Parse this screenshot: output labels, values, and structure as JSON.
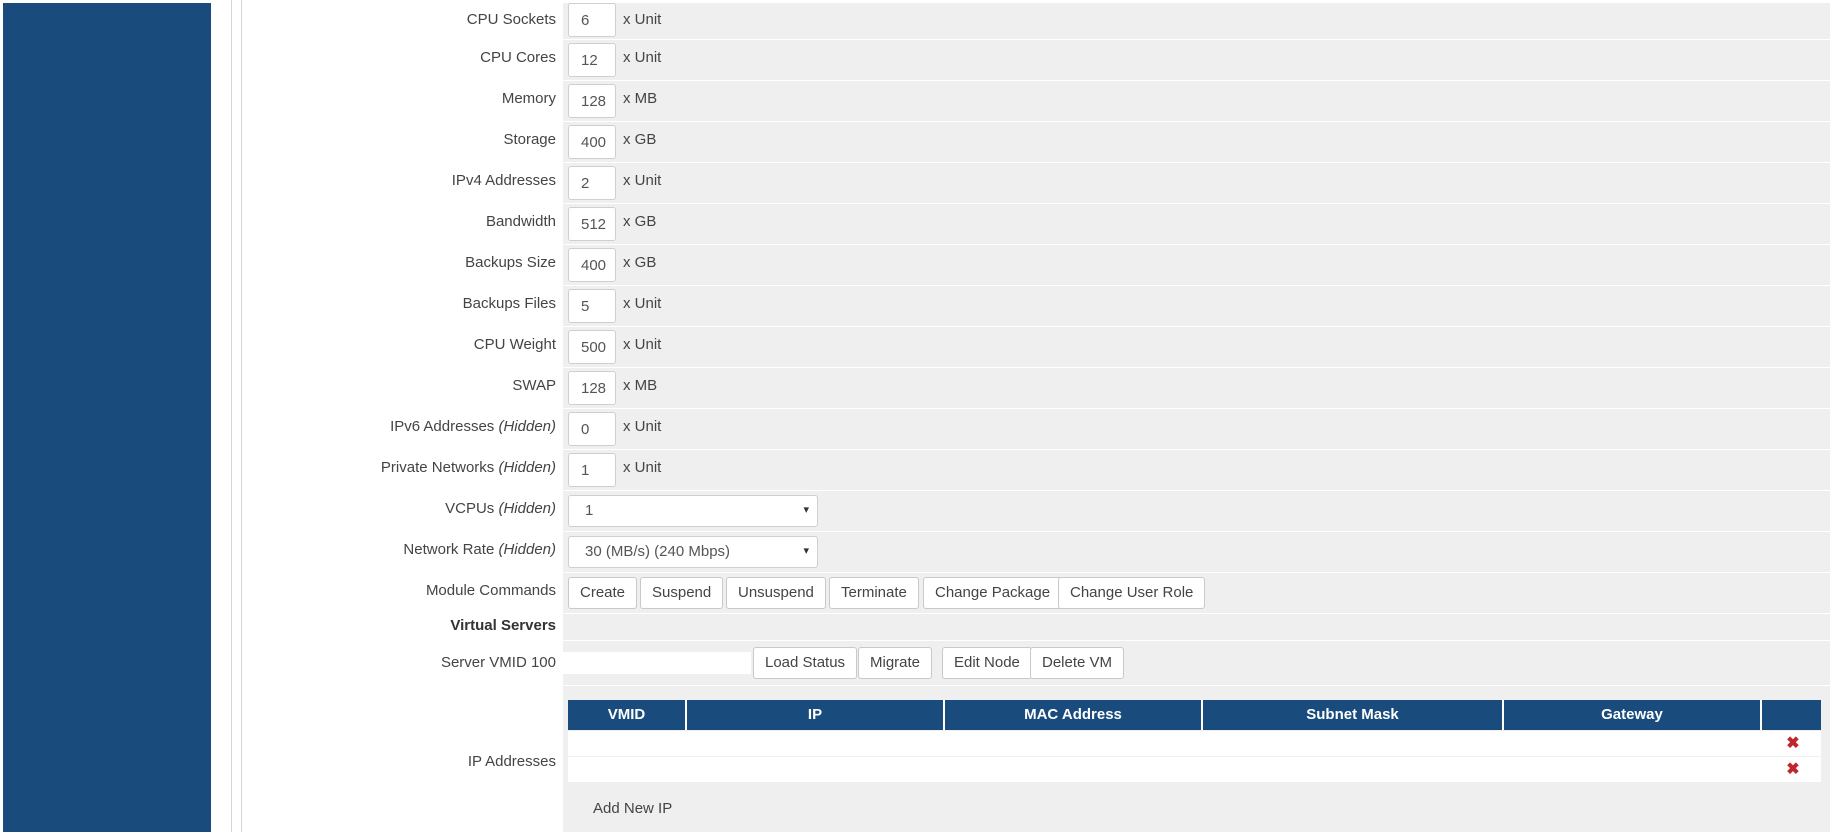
{
  "fields": [
    {
      "label": "CPU Sockets",
      "value": "6",
      "unit": "x Unit"
    },
    {
      "label": "CPU Cores",
      "value": "12",
      "unit": "x Unit"
    },
    {
      "label": "Memory",
      "value": "128",
      "unit": "x MB"
    },
    {
      "label": "Storage",
      "value": "400",
      "unit": "x GB"
    },
    {
      "label": "IPv4 Addresses",
      "value": "2",
      "unit": "x Unit"
    },
    {
      "label": "Bandwidth",
      "value": "512",
      "unit": "x GB"
    },
    {
      "label": "Backups Size",
      "value": "400",
      "unit": "x GB"
    },
    {
      "label": "Backups Files",
      "value": "5",
      "unit": "x Unit"
    },
    {
      "label": "CPU Weight",
      "value": "500",
      "unit": "x Unit"
    },
    {
      "label": "SWAP",
      "value": "128",
      "unit": "x MB"
    },
    {
      "label": "IPv6 Addresses",
      "hidden": "(Hidden)",
      "value": "0",
      "unit": "x Unit"
    },
    {
      "label": "Private Networks",
      "hidden": "(Hidden)",
      "value": "1",
      "unit": "x Unit"
    }
  ],
  "vcpus": {
    "label": "VCPUs",
    "hidden": "(Hidden)",
    "value": "1"
  },
  "network_rate": {
    "label": "Network Rate",
    "hidden": "(Hidden)",
    "value": "30 (MB/s) (240 Mbps)"
  },
  "module_commands": {
    "label": "Module Commands",
    "buttons": [
      "Create",
      "Suspend",
      "Unsuspend",
      "Terminate",
      "Change Package",
      "Change User Role"
    ]
  },
  "virtual_servers": {
    "label": "Virtual Servers"
  },
  "server_vmid": {
    "label": "Server VMID 100",
    "value": "",
    "buttons": [
      "Load Status",
      "Migrate",
      "Edit Node",
      "Delete VM"
    ]
  },
  "ip_addresses": {
    "label": "IP Addresses",
    "columns": [
      "VMID",
      "IP",
      "MAC Address",
      "Subnet Mask",
      "Gateway",
      ""
    ],
    "rows": [
      {
        "delete_icon": "✖"
      },
      {
        "delete_icon": "✖"
      }
    ],
    "add_label": "Add New IP"
  },
  "icons": {
    "select_caret": "▾",
    "delete": "close-x-icon"
  },
  "colors": {
    "brand_blue": "#1a4b7d",
    "delete_red": "#c0262d",
    "row_bg": "#efefef"
  }
}
